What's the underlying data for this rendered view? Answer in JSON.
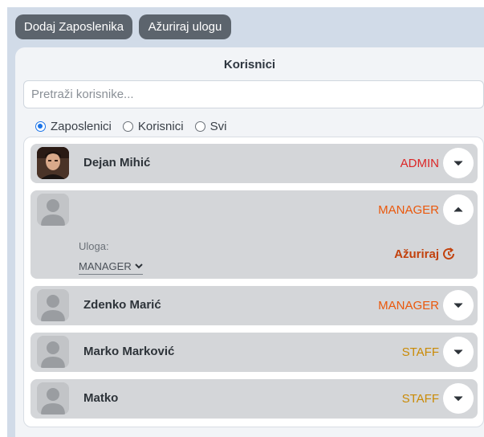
{
  "toolbar": {
    "add_employee_label": "Dodaj Zaposlenika",
    "update_role_label": "Ažuriraj ulogu"
  },
  "panel": {
    "title": "Korisnici",
    "search_placeholder": "Pretraži korisnike...",
    "filters": [
      {
        "label": "Zaposlenici",
        "checked": true
      },
      {
        "label": "Korisnici",
        "checked": false
      },
      {
        "label": "Svi",
        "checked": false
      }
    ]
  },
  "users": [
    {
      "name": "Dejan Mihić",
      "role": "ADMIN",
      "role_color": "#dc2626",
      "avatar": "photo",
      "expanded": false
    },
    {
      "name": "",
      "role": "MANAGER",
      "role_color": "#ea580c",
      "avatar": "placeholder",
      "expanded": true
    },
    {
      "name": "Zdenko Marić",
      "role": "MANAGER",
      "role_color": "#ea580c",
      "avatar": "placeholder",
      "expanded": false
    },
    {
      "name": "Marko Marković",
      "role": "STAFF",
      "role_color": "#ca8a04",
      "avatar": "placeholder",
      "expanded": false
    },
    {
      "name": "Matko",
      "role": "STAFF",
      "role_color": "#ca8a04",
      "avatar": "placeholder",
      "expanded": false
    }
  ],
  "expanded_editor": {
    "role_label": "Uloga:",
    "selected_role": "MANAGER",
    "update_label": "Ažuriraj",
    "update_color": "#c2410c"
  },
  "colors": {
    "button_bg": "#5c646d",
    "background": "#d1dbe8",
    "row_bg": "#d4d6d9"
  }
}
